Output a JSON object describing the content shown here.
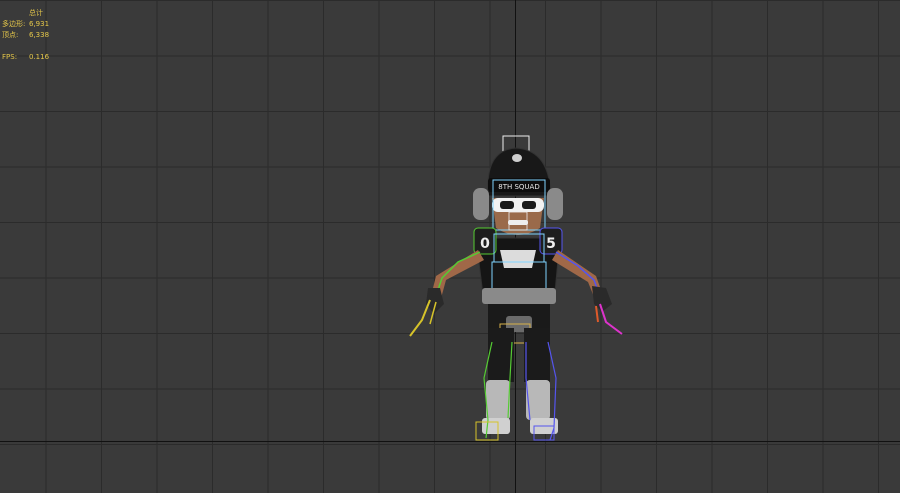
{
  "stats": {
    "header": "总计",
    "polygons_label": "多边形:",
    "polygons_value": "6,931",
    "vertices_label": "顶点:",
    "vertices_value": "6,338",
    "fps_label": "FPS:",
    "fps_value": "0.116"
  },
  "colors": {
    "background": "#3a3a3a",
    "grid": "#2b2b2b",
    "axis": "#111111",
    "stats_text": "#e6c84a",
    "bone_left": "#55cc33",
    "bone_right": "#5555ee",
    "bone_center": "#7fd4ff",
    "bone_hand_left": "#d6c32a",
    "bone_hand_right": "#dd33cc",
    "pelvis_box": "#d8b24a"
  },
  "viewport": {
    "character_text": "8TH SQUAD",
    "left_pad_number": "0",
    "right_pad_number": "5"
  }
}
